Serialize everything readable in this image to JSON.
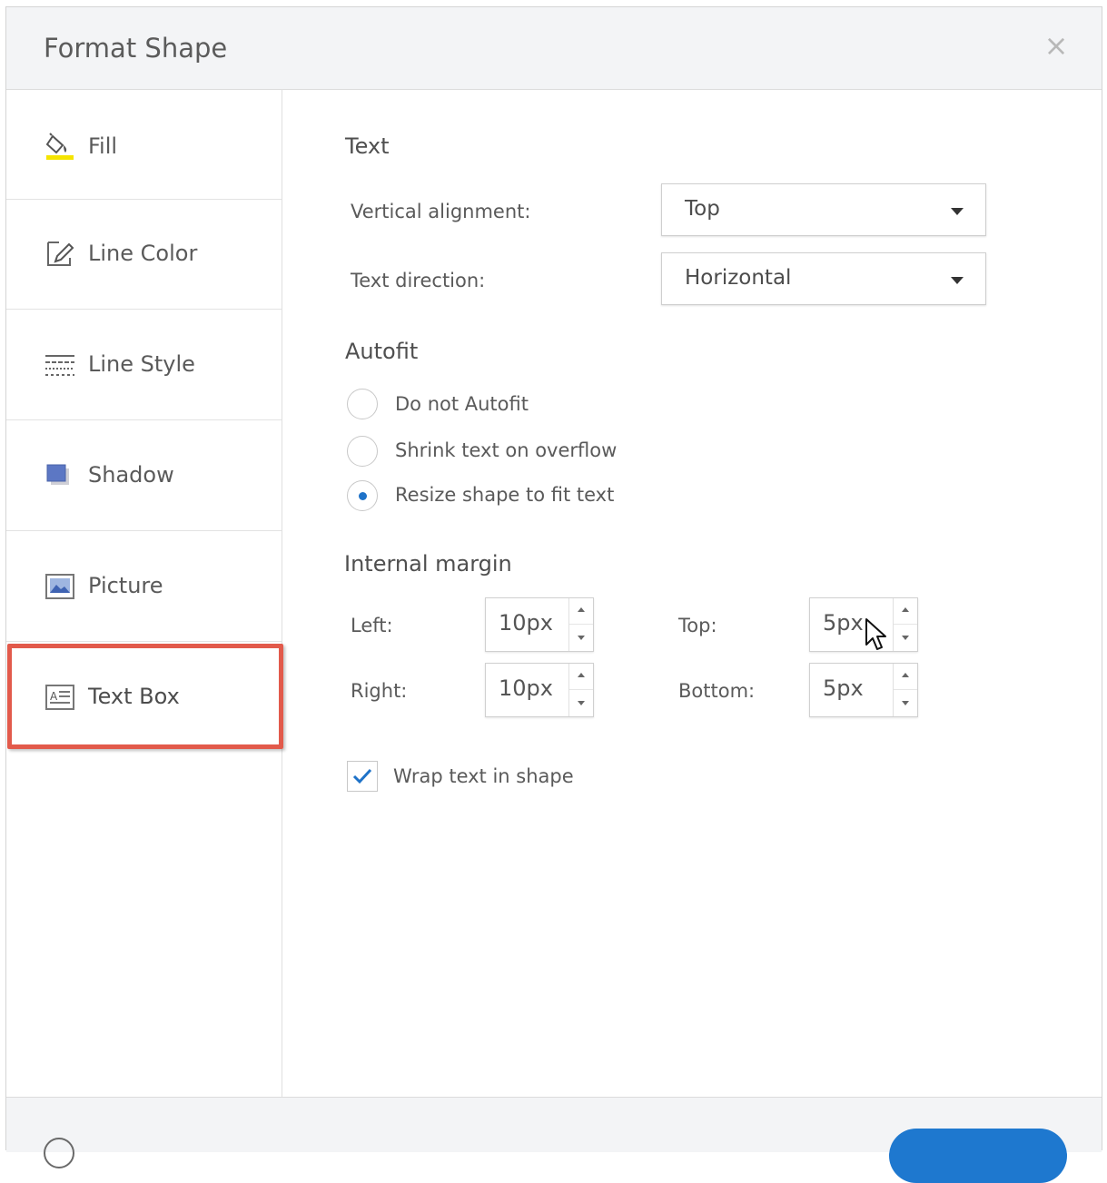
{
  "dialog": {
    "title": "Format Shape",
    "close_symbol": "×"
  },
  "sidebar": {
    "items": [
      {
        "label": "Fill",
        "icon": "paint-bucket-icon"
      },
      {
        "label": "Line Color",
        "icon": "pencil-icon"
      },
      {
        "label": "Line Style",
        "icon": "line-style-icon"
      },
      {
        "label": "Shadow",
        "icon": "shadow-icon"
      },
      {
        "label": "Picture",
        "icon": "picture-icon"
      },
      {
        "label": "Text Box",
        "icon": "text-box-icon",
        "active": true
      }
    ],
    "highlight_color": "#e25a4b"
  },
  "text_section": {
    "title": "Text",
    "vertical_alignment_label": "Vertical alignment:",
    "vertical_alignment_value": "Top",
    "text_direction_label": "Text direction:",
    "text_direction_value": "Horizontal"
  },
  "autofit": {
    "title": "Autofit",
    "options": [
      {
        "label": "Do not Autofit",
        "checked": false
      },
      {
        "label": "Shrink text on overflow",
        "checked": false
      },
      {
        "label": "Resize shape to fit text",
        "checked": true
      }
    ]
  },
  "margin": {
    "title": "Internal margin",
    "left_label": "Left:",
    "left_value": "10px",
    "right_label": "Right:",
    "right_value": "10px",
    "top_label": "Top:",
    "top_value": "5px",
    "bottom_label": "Bottom:",
    "bottom_value": "5px"
  },
  "wrap": {
    "label": "Wrap text in shape",
    "checked": true
  },
  "colors": {
    "accent": "#1e78cf",
    "check": "#1e72c8"
  }
}
